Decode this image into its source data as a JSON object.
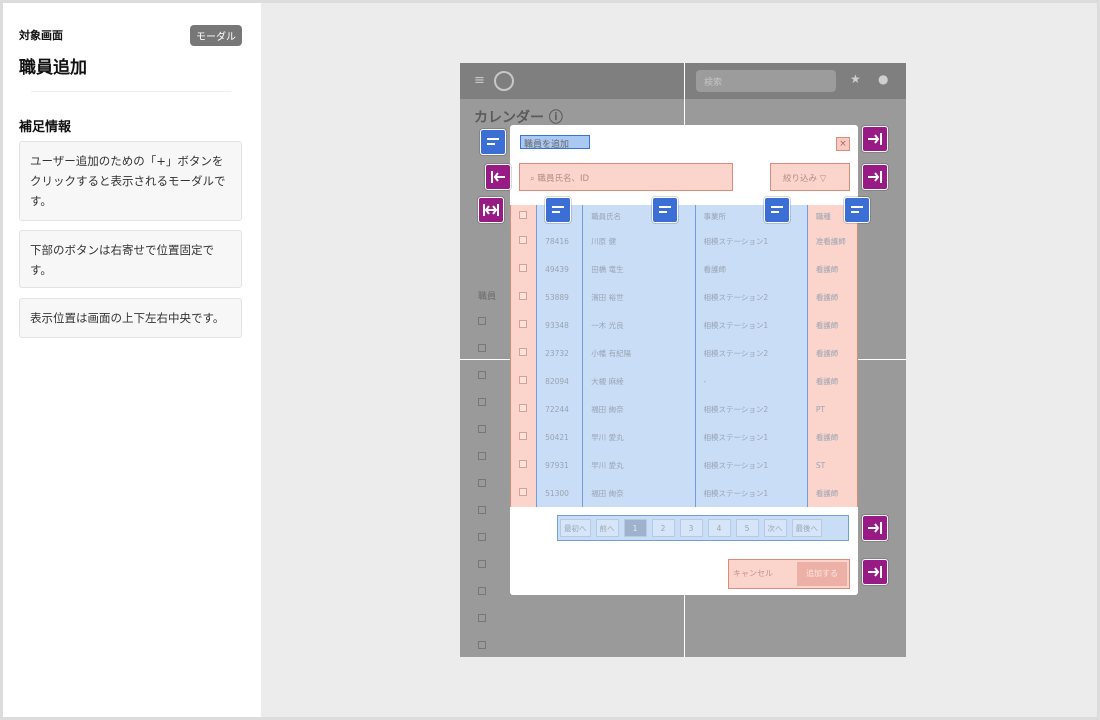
{
  "side": {
    "screen_label": "対象画面",
    "badge": "モーダル",
    "title": "職員追加",
    "section_title": "補足情報",
    "notes": [
      "ユーザー追加のための「+」ボタンをクリックすると表示されるモーダルです。",
      "下部のボタンは右寄せで位置固定です。",
      "表示位置は画面の上下左右中央です。"
    ]
  },
  "app": {
    "search_placeholder": "検索",
    "page_heading": "カレンダー ⓘ",
    "bg_section": "職員"
  },
  "modal": {
    "title": "職員を追加",
    "close": "×",
    "search_placeholder": "職員氏名、ID",
    "filter_label": "絞り込み",
    "headers": [
      "",
      "",
      "職員氏名",
      "事業所",
      "職種"
    ],
    "rows": [
      {
        "id": "78416",
        "name": "川原 健",
        "station": "相模ステーション1",
        "job": "准看護師"
      },
      {
        "id": "49439",
        "name": "田橋 竜生",
        "station": "看護師",
        "job": "看護師"
      },
      {
        "id": "53889",
        "name": "濱田 裕世",
        "station": "相模ステーション2",
        "job": "看護師"
      },
      {
        "id": "93348",
        "name": "一木 光良",
        "station": "相模ステーション1",
        "job": "看護師"
      },
      {
        "id": "23732",
        "name": "小幡 有紀陽",
        "station": "相模ステーション2",
        "job": "看護師"
      },
      {
        "id": "82094",
        "name": "大槻 麻綾",
        "station": "-",
        "job": "看護師"
      },
      {
        "id": "72244",
        "name": "福田 絢奈",
        "station": "相模ステーション2",
        "job": "PT"
      },
      {
        "id": "50421",
        "name": "早川 愛丸",
        "station": "相模ステーション1",
        "job": "看護師"
      },
      {
        "id": "97931",
        "name": "早川 愛丸",
        "station": "相模ステーション1",
        "job": "ST"
      },
      {
        "id": "51300",
        "name": "福田 絢奈",
        "station": "相模ステーション1",
        "job": "看護師"
      }
    ],
    "pagination": [
      "最初へ",
      "前へ",
      "1",
      "2",
      "3",
      "4",
      "5",
      "次へ",
      "最後へ"
    ],
    "active_page": "1",
    "cancel_label": "キャンセル",
    "add_label": "追加する"
  },
  "colors": {
    "blue_marker": "#3b6fd6",
    "purple_marker": "#981a84",
    "blue_region": "#c9ddf7",
    "red_region": "#fbd4cc"
  }
}
